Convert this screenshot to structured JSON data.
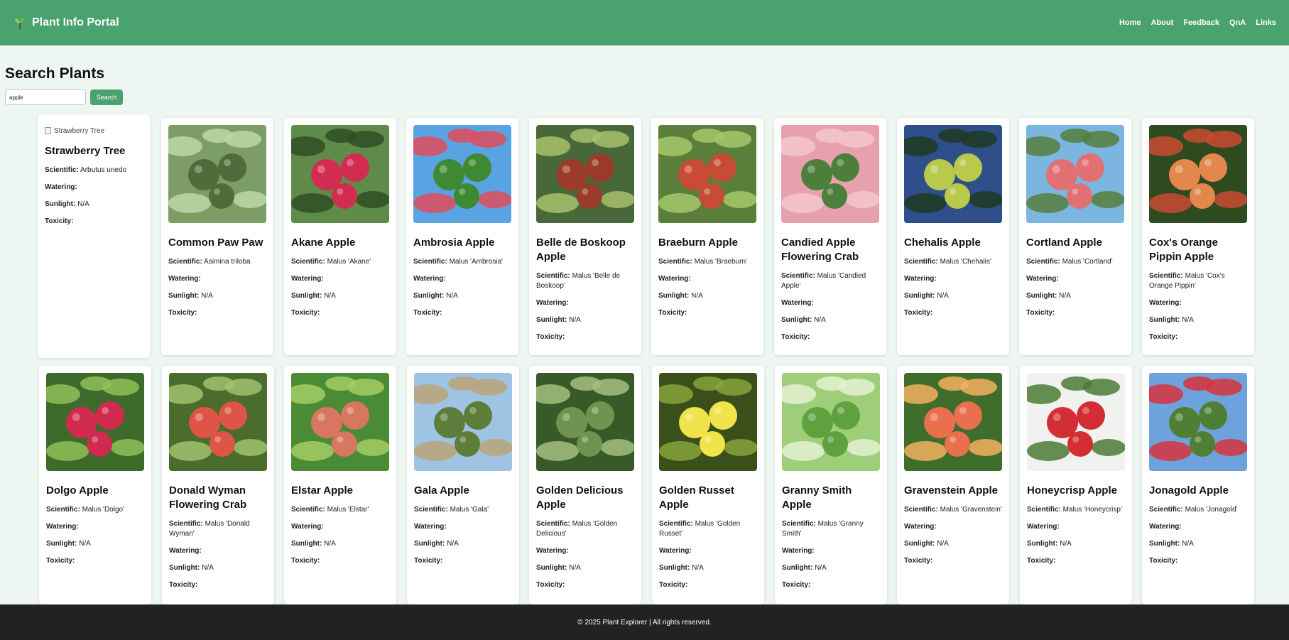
{
  "header": {
    "brand": "Plant Info Portal",
    "nav": [
      "Home",
      "About",
      "Feedback",
      "QnA",
      "Links"
    ]
  },
  "search": {
    "title": "Search Plants",
    "query": "apple",
    "button": "Search"
  },
  "labels": {
    "scientific": "Scientific:",
    "watering": "Watering:",
    "sunlight": "Sunlight:",
    "toxicity": "Toxicity:"
  },
  "plants": [
    {
      "name": "Strawberry Tree",
      "scientific": "Arbutus unedo",
      "watering": "",
      "sunlight": "N/A",
      "toxicity": "",
      "img_alt": "Strawberry Tree",
      "palette": [
        "#c7e1a0",
        "#8bb66f",
        "#3d6d2f"
      ]
    },
    {
      "name": "Common Paw Paw",
      "scientific": "Asimina triloba",
      "watering": "",
      "sunlight": "N/A",
      "toxicity": "",
      "palette": [
        "#7c9d65",
        "#4e6d3a",
        "#bcd8a8"
      ]
    },
    {
      "name": "Akane Apple",
      "scientific": "Malus 'Akane'",
      "watering": "",
      "sunlight": "N/A",
      "toxicity": "",
      "palette": [
        "#5e8b4a",
        "#d22d50",
        "#2f4d24"
      ]
    },
    {
      "name": "Ambrosia Apple",
      "scientific": "Malus 'Ambrosia'",
      "watering": "",
      "sunlight": "N/A",
      "toxicity": "",
      "palette": [
        "#5aa3e3",
        "#3e8a33",
        "#e14c5b"
      ]
    },
    {
      "name": "Belle de Boskoop Apple",
      "scientific": "Malus 'Belle de Boskoop'",
      "watering": "",
      "sunlight": "N/A",
      "toxicity": "",
      "palette": [
        "#49683a",
        "#9b3b2b",
        "#a7c06b"
      ]
    },
    {
      "name": "Braeburn Apple",
      "scientific": "Malus 'Braeburn'",
      "watering": "",
      "sunlight": "N/A",
      "toxicity": "",
      "palette": [
        "#5a7f3a",
        "#c84b33",
        "#a6c76a"
      ]
    },
    {
      "name": "Candied Apple Flowering Crab",
      "scientific": "Malus 'Candied Apple'",
      "watering": "",
      "sunlight": "N/A",
      "toxicity": "",
      "palette": [
        "#e6a1ad",
        "#4d7f3c",
        "#f3c6cb"
      ]
    },
    {
      "name": "Chehalis Apple",
      "scientific": "Malus 'Chehalis'",
      "watering": "",
      "sunlight": "N/A",
      "toxicity": "",
      "palette": [
        "#2f4f8a",
        "#b9c94b",
        "#1f3a22"
      ]
    },
    {
      "name": "Cortland Apple",
      "scientific": "Malus 'Cortland'",
      "watering": "",
      "sunlight": "N/A",
      "toxicity": "",
      "palette": [
        "#7ab6e0",
        "#e27073",
        "#557f3c"
      ]
    },
    {
      "name": "Cox's Orange Pippin Apple",
      "scientific": "Malus 'Cox's Orange Pippin'",
      "watering": "",
      "sunlight": "N/A",
      "toxicity": "",
      "palette": [
        "#2e4a1f",
        "#e4874c",
        "#c94a32"
      ]
    },
    {
      "name": "Dolgo Apple",
      "scientific": "Malus 'Dolgo'",
      "watering": "",
      "sunlight": "N/A",
      "toxicity": "",
      "palette": [
        "#3c6b2b",
        "#d02b4e",
        "#8fbf58"
      ]
    },
    {
      "name": "Donald Wyman Flowering Crab",
      "scientific": "Malus 'Donald Wyman'",
      "watering": "",
      "sunlight": "N/A",
      "toxicity": "",
      "palette": [
        "#4a6c2d",
        "#de5547",
        "#9ec26d"
      ]
    },
    {
      "name": "Elstar Apple",
      "scientific": "Malus 'Elstar'",
      "watering": "",
      "sunlight": "N/A",
      "toxicity": "",
      "palette": [
        "#4a8b35",
        "#d87760",
        "#a3cc63"
      ]
    },
    {
      "name": "Gala Apple",
      "scientific": "Malus 'Gala'",
      "watering": "",
      "sunlight": "N/A",
      "toxicity": "",
      "palette": [
        "#9fc3e3",
        "#5c7e3a",
        "#b9a478"
      ]
    },
    {
      "name": "Golden Delicious Apple",
      "scientific": "Malus 'Golden Delicious'",
      "watering": "",
      "sunlight": "N/A",
      "toxicity": "",
      "palette": [
        "#375a28",
        "#6e9450",
        "#a3c07f"
      ]
    },
    {
      "name": "Golden Russet Apple",
      "scientific": "Malus 'Golden Russet'",
      "watering": "",
      "sunlight": "N/A",
      "toxicity": "",
      "palette": [
        "#3b4f1a",
        "#f0e44a",
        "#86a23b"
      ]
    },
    {
      "name": "Granny Smith Apple",
      "scientific": "Malus 'Granny Smith'",
      "watering": "",
      "sunlight": "N/A",
      "toxicity": "",
      "palette": [
        "#9fce7a",
        "#5fa13f",
        "#e3f1d1"
      ]
    },
    {
      "name": "Gravenstein Apple",
      "scientific": "Malus 'Gravenstein'",
      "watering": "",
      "sunlight": "N/A",
      "toxicity": "",
      "palette": [
        "#3f6e2c",
        "#ea6f4f",
        "#f2b05e"
      ]
    },
    {
      "name": "Honeycrisp Apple",
      "scientific": "Malus 'Honeycrisp'",
      "watering": "",
      "sunlight": "N/A",
      "toxicity": "",
      "palette": [
        "#f1f2ef",
        "#d32e35",
        "#4b7b36"
      ]
    },
    {
      "name": "Jonagold Apple",
      "scientific": "Malus 'Jonagold'",
      "watering": "",
      "sunlight": "N/A",
      "toxicity": "",
      "palette": [
        "#6ea2dc",
        "#4f7f34",
        "#d7343d"
      ]
    }
  ],
  "footer": "© 2025 Plant Explorer | All rights reserved."
}
